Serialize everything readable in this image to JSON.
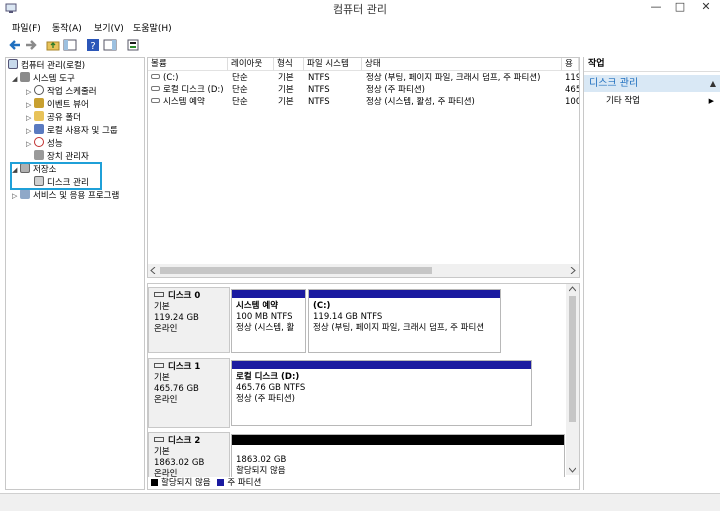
{
  "window": {
    "title": "컴퓨터 관리",
    "minimize": "—",
    "maximize": "□",
    "close": "✕"
  },
  "menu": [
    "파일(F)",
    "동작(A)",
    "보기(V)",
    "도움말(H)"
  ],
  "tree": [
    {
      "label": "컴퓨터 관리(로컬)",
      "level": 0,
      "toggle": "",
      "icon": "computer-icon"
    },
    {
      "label": "시스템 도구",
      "level": 1,
      "toggle": "◢",
      "icon": "tools-icon"
    },
    {
      "label": "작업 스케줄러",
      "level": 2,
      "toggle": "▷",
      "icon": "clock-icon"
    },
    {
      "label": "이벤트 뷰어",
      "level": 2,
      "toggle": "▷",
      "icon": "event-icon"
    },
    {
      "label": "공유 폴더",
      "level": 2,
      "toggle": "▷",
      "icon": "folder-icon"
    },
    {
      "label": "로컬 사용자 및 그룹",
      "level": 2,
      "toggle": "▷",
      "icon": "users-icon"
    },
    {
      "label": "성능",
      "level": 2,
      "toggle": "▷",
      "icon": "performance-icon"
    },
    {
      "label": "장치 관리자",
      "level": 2,
      "toggle": "",
      "icon": "device-icon"
    },
    {
      "label": "저장소",
      "level": 1,
      "toggle": "◢",
      "icon": "storage-icon"
    },
    {
      "label": "디스크 관리",
      "level": 2,
      "toggle": "",
      "icon": "disk-icon"
    },
    {
      "label": "서비스 및 응용 프로그램",
      "level": 1,
      "toggle": "▷",
      "icon": "services-icon"
    }
  ],
  "volumes": {
    "headers": [
      "볼륨",
      "레이아웃",
      "형식",
      "파일 시스템",
      "상태",
      "용"
    ],
    "rows": [
      [
        "(C:)",
        "단순",
        "기본",
        "NTFS",
        "정상 (부팅, 페이지 파일, 크래시 덤프, 주 파티션)",
        "119"
      ],
      [
        "로컬 디스크 (D:)",
        "단순",
        "기본",
        "NTFS",
        "정상 (주 파티션)",
        "465"
      ],
      [
        "시스템 예약",
        "단순",
        "기본",
        "NTFS",
        "정상 (시스템, 활성, 주 파티션)",
        "100"
      ]
    ]
  },
  "disks": [
    {
      "name": "디스크 0",
      "type": "기본",
      "size": "119.24 GB",
      "status": "온라인",
      "partitions": [
        {
          "name": "시스템 예약",
          "size": "100 MB NTFS",
          "status": "정상 (시스템, 활"
        },
        {
          "name": "(C:)",
          "size": "119.14 GB NTFS",
          "status": "정상 (부팅, 페이지 파일, 크래시 덤프, 주 파티션"
        }
      ]
    },
    {
      "name": "디스크 1",
      "type": "기본",
      "size": "465.76 GB",
      "status": "온라인",
      "partitions": [
        {
          "name": "로컬 디스크  (D:)",
          "size": "465.76 GB NTFS",
          "status": "정상 (주 파티션)"
        }
      ]
    },
    {
      "name": "디스크 2",
      "type": "기본",
      "size": "1863.02 GB",
      "status": "온라인",
      "partitions": [
        {
          "name": "",
          "size": "1863.02 GB",
          "status": "할당되지 않음"
        }
      ]
    }
  ],
  "legend": [
    "할당되지 않음",
    "주 파티션"
  ],
  "actions": {
    "header": "작업",
    "selected": "디스크 관리",
    "more": "기타 작업"
  },
  "colors": {
    "primary_partition": "#1a1aa0",
    "unallocated": "#000000",
    "highlight_box": "#1fa0d8"
  }
}
